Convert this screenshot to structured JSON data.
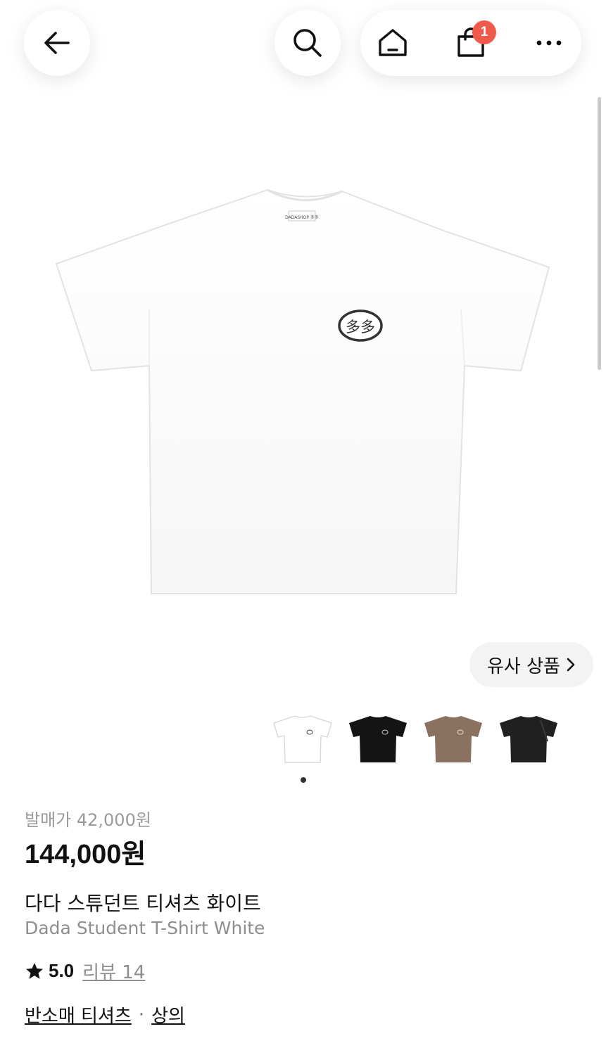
{
  "header": {
    "back_icon": "arrow-left-icon",
    "search_icon": "search-icon",
    "home_icon": "home-icon",
    "cart_icon": "shopping-bag-icon",
    "cart_count": "1",
    "more_icon": "more-horizontal-icon",
    "badge_color": "#ef5a4a"
  },
  "hero": {
    "shirt_color": "#ffffff",
    "logo_text": "多多",
    "tag_text": "DADASHOP 多多"
  },
  "similar_button": {
    "label": "유사 상품"
  },
  "thumbnails": [
    {
      "color": "#ffffff",
      "name": "white"
    },
    {
      "color": "#141414",
      "name": "black"
    },
    {
      "color": "#8a7160",
      "name": "brown"
    },
    {
      "color": "#202020",
      "name": "black-2"
    }
  ],
  "product": {
    "wholesale_price": "발매가 42,000원",
    "price": "144,000원",
    "name_ko": "다다 스튜던트 티셔츠 화이트",
    "name_en": "Dada Student T-Shirt White",
    "rating": "5.0",
    "review_label": "리뷰 14",
    "category": "반소매 티셔츠",
    "separator": "·",
    "parent_category": "상의"
  }
}
